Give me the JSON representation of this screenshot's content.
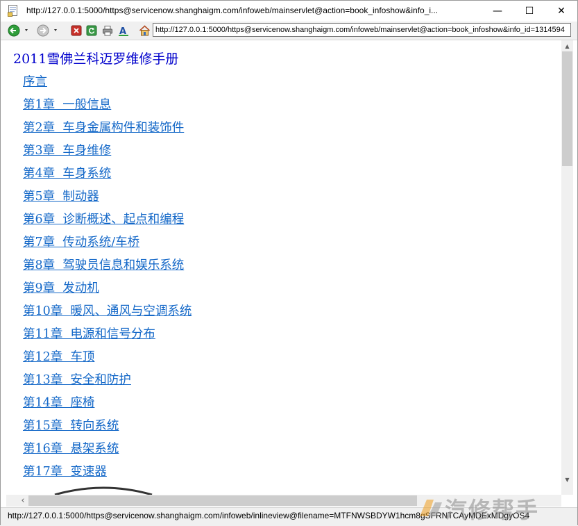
{
  "window": {
    "title": "http://127.0.0.1:5000/https@servicenow.shanghaigm.com/infoweb/mainservlet@action=book_infoshow&info_i...",
    "minimize_glyph": "—",
    "maximize_glyph": "☐",
    "close_glyph": "✕"
  },
  "address_bar": {
    "value": "http://127.0.0.1:5000/https@servicenow.shanghaigm.com/infoweb/mainservlet@action=book_infoshow&info_id=1314594"
  },
  "document": {
    "title": "2011雪佛兰科迈罗维修手册",
    "toc": [
      "序言",
      "第1章  一般信息",
      "第2章  车身金属构件和装饰件",
      "第3章  车身维修",
      "第4章  车身系统",
      "第5章  制动器",
      "第6章  诊断概述、起点和编程",
      "第7章  传动系统/车桥",
      "第8章  驾驶员信息和娱乐系统",
      "第9章  发动机",
      "第10章  暖风、通风与空调系统",
      "第11章  电源和信号分布",
      "第12章  车顶",
      "第13章  安全和防护",
      "第14章  座椅",
      "第15章  转向系统",
      "第16章  悬架系统",
      "第17章  变速器"
    ]
  },
  "status_bar": {
    "text": "http://127.0.0.1:5000/https@servicenow.shanghaigm.com/infoweb/inlineview@filename=MTFNWSBDYW1hcm8gSFRNTCAyMDExMDgyOS4"
  },
  "watermark": {
    "text": "汽修帮手"
  },
  "colors": {
    "title_blue": "#0000cc",
    "link_blue": "#1468c8"
  }
}
